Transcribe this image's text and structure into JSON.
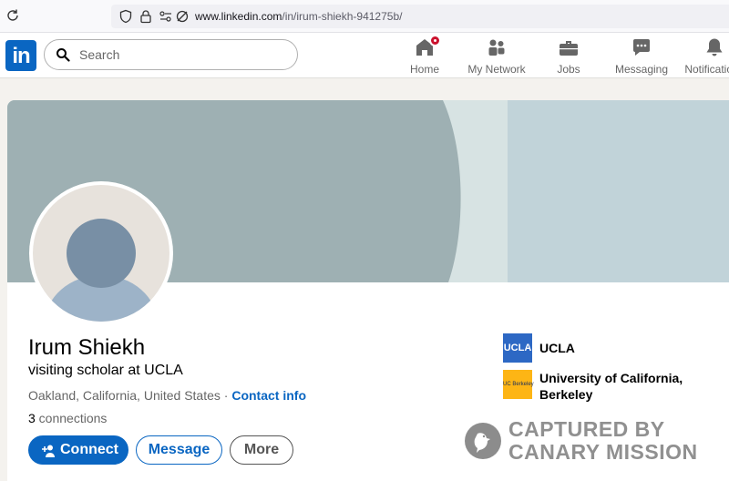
{
  "browser": {
    "url_host": "www.linkedin.com",
    "url_path": "/in/irum-shiekh-941275b/"
  },
  "nav": {
    "logo": "in",
    "search_placeholder": "Search",
    "items": [
      {
        "label": "Home",
        "icon": "home-icon",
        "has_badge": true
      },
      {
        "label": "My Network",
        "icon": "people-icon"
      },
      {
        "label": "Jobs",
        "icon": "briefcase-icon"
      },
      {
        "label": "Messaging",
        "icon": "chat-icon"
      },
      {
        "label": "Notifications",
        "icon": "bell-icon"
      }
    ]
  },
  "profile": {
    "name": "Irum Shiekh",
    "headline": "visiting scholar at UCLA",
    "location": "Oakland, California, United States",
    "separator": " · ",
    "contact_info": "Contact info",
    "connections_count": "3",
    "connections_label": " connections",
    "buttons": {
      "connect": "Connect",
      "message": "Message",
      "more": "More"
    },
    "education": [
      {
        "logo": "UCLA",
        "name": "UCLA",
        "logo_color": "#2d68c4"
      },
      {
        "logo": "UC Berkeley",
        "name_line1": "University of California,",
        "name_line2": "Berkeley",
        "logo_color": "#fdb515"
      }
    ]
  },
  "watermark": {
    "line1": "CAPTURED BY",
    "line2": "CANARY MISSION"
  },
  "colors": {
    "brand": "#0a66c2",
    "badge": "#cb112d",
    "banner_light": "#c1d3d9",
    "banner_dark": "#9eb0b3"
  }
}
